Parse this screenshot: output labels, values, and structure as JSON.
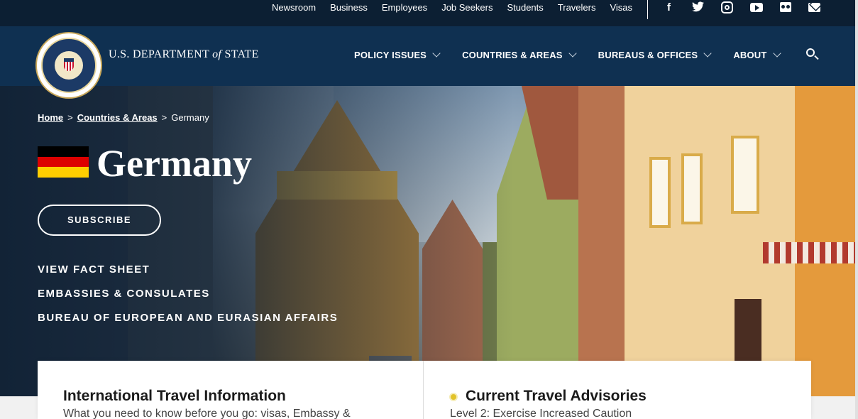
{
  "utility": {
    "links": [
      "Newsroom",
      "Business",
      "Employees",
      "Job Seekers",
      "Students",
      "Travelers",
      "Visas"
    ],
    "social": [
      "facebook-icon",
      "twitter-icon",
      "instagram-icon",
      "youtube-icon",
      "flickr-icon",
      "email-icon"
    ]
  },
  "header": {
    "brand_main": "U.S. DEPARTMENT",
    "brand_of": "of",
    "brand_end": "STATE",
    "nav": [
      "POLICY ISSUES",
      "COUNTRIES & AREAS",
      "BUREAUS & OFFICES",
      "ABOUT"
    ]
  },
  "hero": {
    "breadcrumb": {
      "home": "Home",
      "countries": "Countries & Areas",
      "sep": ">",
      "current": "Germany"
    },
    "title": "Germany",
    "flag_colors": [
      "#000000",
      "#dd0000",
      "#ffce00"
    ],
    "subscribe": "SUBSCRIBE",
    "links": [
      "VIEW FACT SHEET",
      "EMBASSIES & CONSULATES",
      "BUREAU OF EUROPEAN AND EURASIAN AFFAIRS"
    ]
  },
  "cards": {
    "left": {
      "title": "International Travel Information",
      "subtitle": "What you need to know before you go: visas, Embassy &"
    },
    "right": {
      "title": "Current Travel Advisories",
      "subtitle": "Level 2: Exercise Increased Caution"
    }
  },
  "colors": {
    "utility_bg": "#0c1f33",
    "nav_bg": "#0f3051",
    "advisory_dot": "#e2c32a"
  }
}
